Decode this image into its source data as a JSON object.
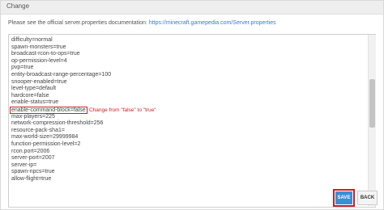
{
  "header": {
    "title": "Change"
  },
  "doc_note": {
    "prefix": "Please see the official server.properties documentation:",
    "link": "https://minecraft.gamepedia.com/Server.properties"
  },
  "editor": {
    "lines": [
      "difficulty=normal",
      "spawn-monsters=true",
      "broadcast-rcon-to-ops=true",
      "op-permission-level=4",
      "pvp=true",
      "entity-broadcast-range-percentage=100",
      "snooper-enabled=true",
      "level-type=default",
      "hardcore=false",
      "enable-status=true",
      "enable-command-block=false",
      "max-players=225",
      "network-compression-threshold=256",
      "resource-pack-sha1=",
      "max-world-size=29999984",
      "function-permission-level=2",
      "rcon.port=2006",
      "server-port=2007",
      "server-ip=",
      "spawn-npcs=true",
      "allow-flight=true"
    ],
    "annotation": "Change from \"false\" to \"true\""
  },
  "actions": {
    "change_label": "SAVE",
    "back_label": "BACK"
  },
  "colors": {
    "accent": "#3a8ed8",
    "highlight": "#cc1f1f"
  }
}
